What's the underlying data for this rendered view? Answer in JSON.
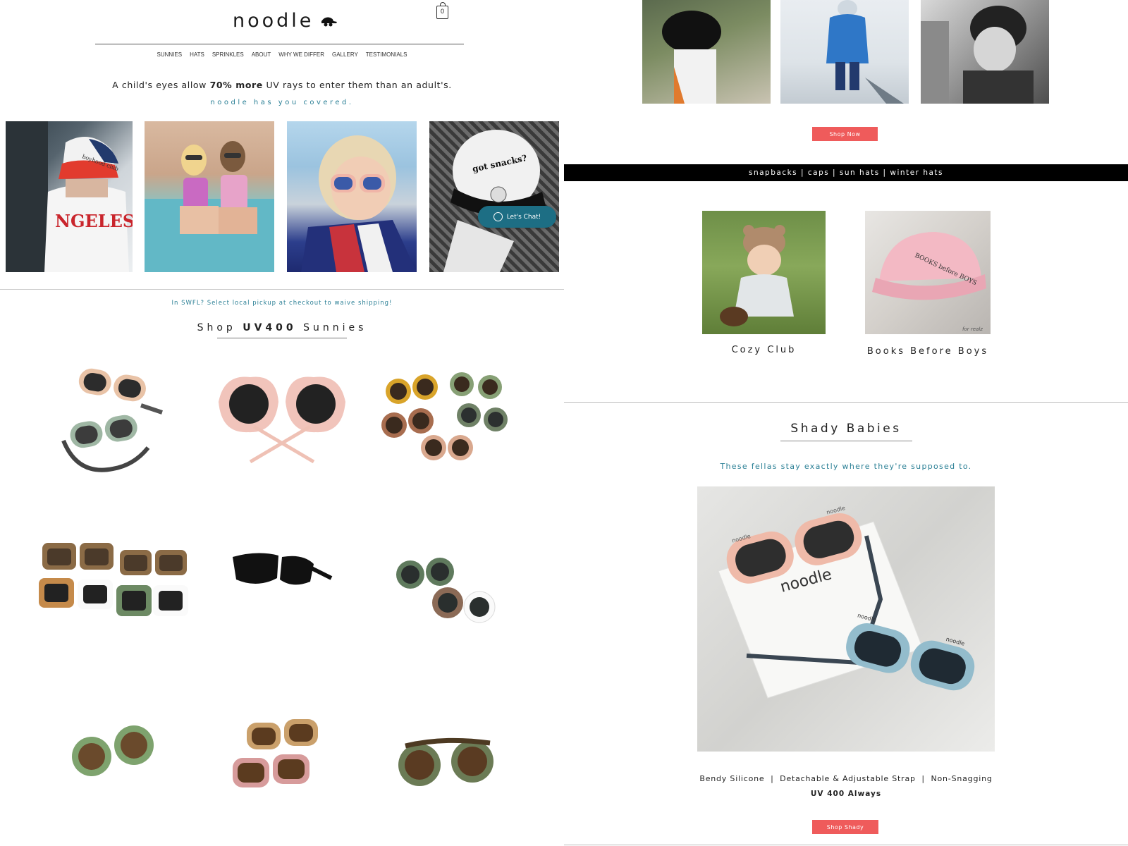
{
  "header": {
    "logo": "noodle",
    "cart_count": "0",
    "nav": [
      "SUNNIES",
      "HATS",
      "SPRINKLES",
      "ABOUT",
      "WHY WE DIFFER",
      "GALLERY",
      "TESTIMONIALS"
    ]
  },
  "hero": {
    "line_pre": "A child's eyes allow ",
    "line_bold": "70% more",
    "line_post": " UV rays to enter them than an adult's.",
    "sub": "noodle has you covered."
  },
  "photos": {
    "p1_text": "boyhood club",
    "p1_shirt": "NGELES",
    "p4_text": "got snacks?"
  },
  "chat": {
    "label": "Let's Chat!"
  },
  "shipping_note": "In SWFL? Select local pickup at checkout to waive shipping!",
  "shop": {
    "pre": "Shop ",
    "bold": "UV400",
    "post": " Sunnies"
  },
  "products": [
    {
      "name": "strap-sunnies-peach-sage",
      "colors": [
        "#e9c3a7",
        "#9fb7a4"
      ]
    },
    {
      "name": "shell-sunnies-pink",
      "colors": [
        "#f1c4bb"
      ]
    },
    {
      "name": "round-sunnies-set",
      "colors": [
        "#d9a42a",
        "#87a075",
        "#a86d4f",
        "#6f8166",
        "#d9a88e"
      ]
    },
    {
      "name": "leopard-square-sunnies",
      "colors": [
        "#8b6b46",
        "#c58a4a",
        "#6d8a64"
      ]
    },
    {
      "name": "classic-black-sunnies",
      "colors": [
        "#111111"
      ]
    },
    {
      "name": "round-two-tone-sunnies",
      "colors": [
        "#5f7a5d",
        "#8b6a56"
      ]
    },
    {
      "name": "round-green-sunnies",
      "colors": [
        "#7ea36e"
      ]
    },
    {
      "name": "leopard-cat-sunnies",
      "colors": [
        "#caa06b",
        "#d79b9b"
      ]
    },
    {
      "name": "round-leopard-green-sunnies",
      "colors": [
        "#6b7b55"
      ]
    }
  ],
  "right": {
    "shop_now": "Shop Now",
    "category_band": "snapbacks | caps | sun hats | winter hats",
    "categories": [
      {
        "label": "Cozy Club"
      },
      {
        "label": "Books Before Boys",
        "cap_text": "BOOKS before BOYS",
        "corner_text": "for realz"
      }
    ],
    "shady_title": "Shady Babies",
    "shady_sub": "These fellas stay exactly where they're supposed to.",
    "shady_photo_text": [
      "noodle",
      "noodle",
      "noodle",
      "noodle",
      "noodle"
    ],
    "features": "Bendy Silicone  |  Detachable & Adjustable Strap  |  Non-Snagging",
    "uv_always": "UV 400 Always",
    "shop_shady": "Shop Shady"
  },
  "colors": {
    "accent": "#2a7f95",
    "button": "#ef5b5b",
    "chat": "#1d6e84",
    "band": "#000000"
  }
}
